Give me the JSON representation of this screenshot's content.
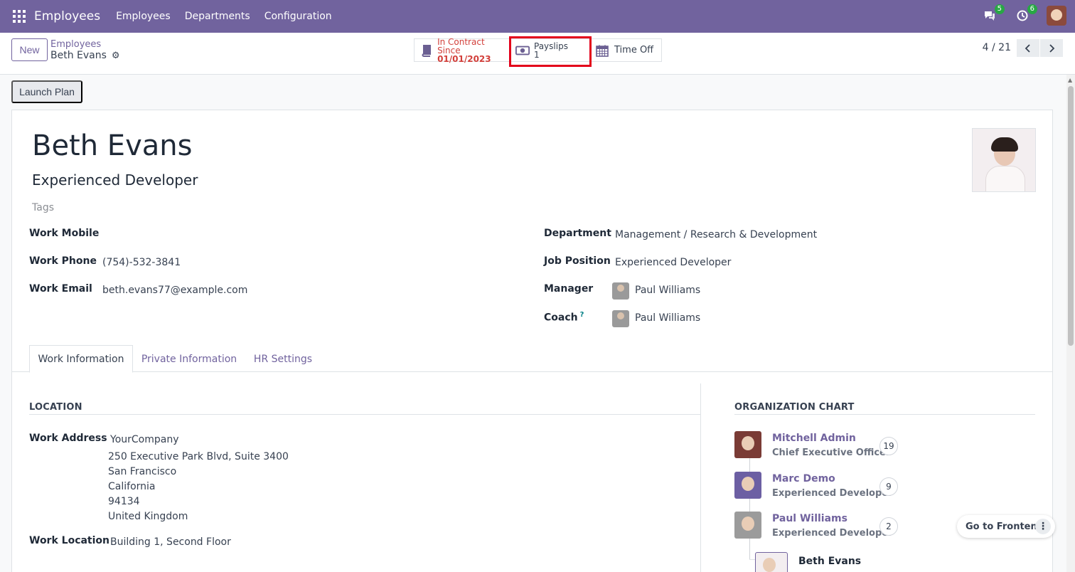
{
  "topbar": {
    "app_title": "Employees",
    "menu": [
      "Employees",
      "Departments",
      "Configuration"
    ],
    "chat_count": "5",
    "activity_count": "6"
  },
  "control": {
    "new_label": "New",
    "breadcrumb_parent": "Employees",
    "breadcrumb_current": "Beth Evans",
    "smart_buttons": {
      "contract_label": "In Contract Since",
      "contract_value": "01/01/2023",
      "payslips_label": "Payslips",
      "payslips_value": "1",
      "timeoff_label": "Time Off"
    },
    "pager": "4 / 21"
  },
  "action": {
    "launch_plan": "Launch Plan"
  },
  "employee": {
    "name": "Beth Evans",
    "job_title": "Experienced Developer",
    "tags_placeholder": "Tags"
  },
  "fields_left": {
    "work_mobile_label": "Work Mobile",
    "work_mobile_value": "",
    "work_phone_label": "Work Phone",
    "work_phone_value": "(754)-532-3841",
    "work_email_label": "Work Email",
    "work_email_value": "beth.evans77@example.com"
  },
  "fields_right": {
    "department_label": "Department",
    "department_value": "Management / Research & Development",
    "job_position_label": "Job Position",
    "job_position_value": "Experienced Developer",
    "manager_label": "Manager",
    "manager_value": "Paul Williams",
    "coach_label": "Coach",
    "coach_help": "?",
    "coach_value": "Paul Williams"
  },
  "tabs": [
    "Work Information",
    "Private Information",
    "HR Settings"
  ],
  "location": {
    "section_title": "LOCATION",
    "work_address_label": "Work Address",
    "address_lines": [
      "YourCompany",
      "250 Executive Park Blvd, Suite 3400",
      "San Francisco",
      "California",
      "94134",
      "United Kingdom"
    ],
    "work_location_label": "Work Location",
    "work_location_value": "Building 1, Second Floor"
  },
  "org_chart": {
    "section_title": "ORGANIZATION CHART",
    "people": [
      {
        "name": "Mitchell Admin",
        "role": "Chief Executive Officer",
        "count": "19",
        "color": "#7a3b35"
      },
      {
        "name": "Marc Demo",
        "role": "Experienced Developer",
        "count": "9",
        "color": "#6c5fa3"
      },
      {
        "name": "Paul Williams",
        "role": "Experienced Developer",
        "count": "2",
        "color": "#9b9b9b"
      }
    ],
    "current": {
      "name": "Beth Evans"
    }
  },
  "floating": {
    "go_to_frontend": "Go to Frontend"
  },
  "colors": {
    "brand": "#71639e",
    "highlight": "#e3001b",
    "contract_red": "#d23f3a"
  }
}
